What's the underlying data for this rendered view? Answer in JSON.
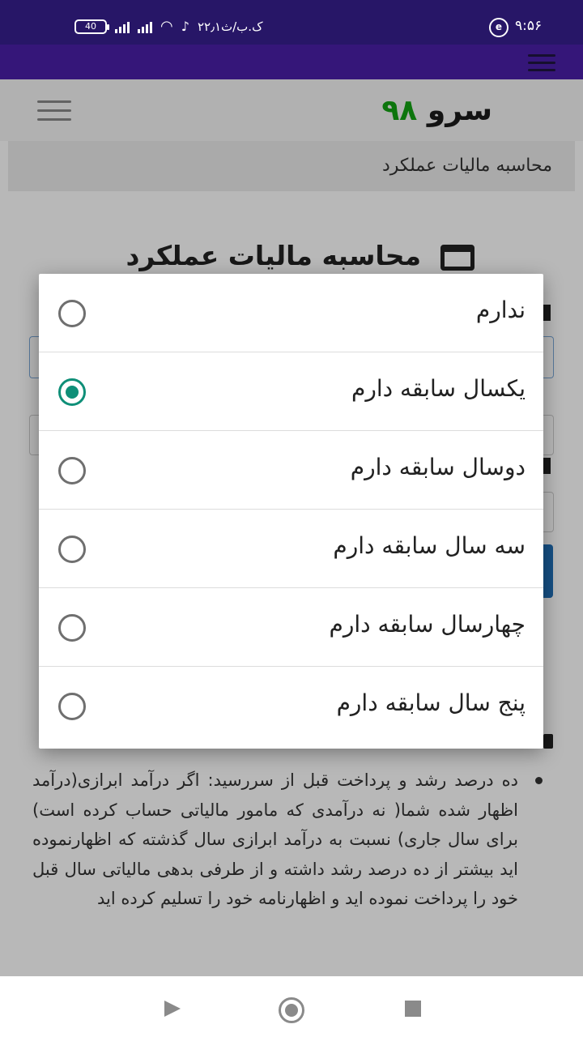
{
  "status_bar": {
    "time": "۹:۵۶",
    "battery": "40",
    "carrier": "۲۲٫۱ک.ب/ث"
  },
  "site": {
    "logo_text": "سرو",
    "logo_number": "۹۸"
  },
  "breadcrumb": "محاسبه مالیات عملکرد",
  "page_title": "محاسبه مالیات عملکرد",
  "dialog": {
    "options": [
      {
        "label": "ندارم",
        "selected": false
      },
      {
        "label": "یکسال سابقه دارم",
        "selected": true
      },
      {
        "label": "دوسال سابقه دارم",
        "selected": false
      },
      {
        "label": "سه سال سابقه دارم",
        "selected": false
      },
      {
        "label": "چهارسال سابقه دارم",
        "selected": false
      },
      {
        "label": "پنج سال سابقه دارم",
        "selected": false
      }
    ]
  },
  "body_text": "ده درصد رشد و پرداخت قبل از سررسید: اگر درآمد ابرازی(درآمد اظهار شده شما( نه درآمدی که مامور مالیاتی حساب کرده است) برای سال جاری) نسبت به درآمد ابرازی سال گذشته که اظهارنموده اید بیشتر از ده درصد رشد داشته و از طرفی بدهی مالیاتی سال قبل خود را پرداخت نموده اید و اظهارنامه خود را تسلیم کرده اید",
  "colors": {
    "status_bar": "#271667",
    "app_bar": "#4a1fa8",
    "radio_selected": "#0f8f78",
    "logo_number": "#13a313"
  }
}
